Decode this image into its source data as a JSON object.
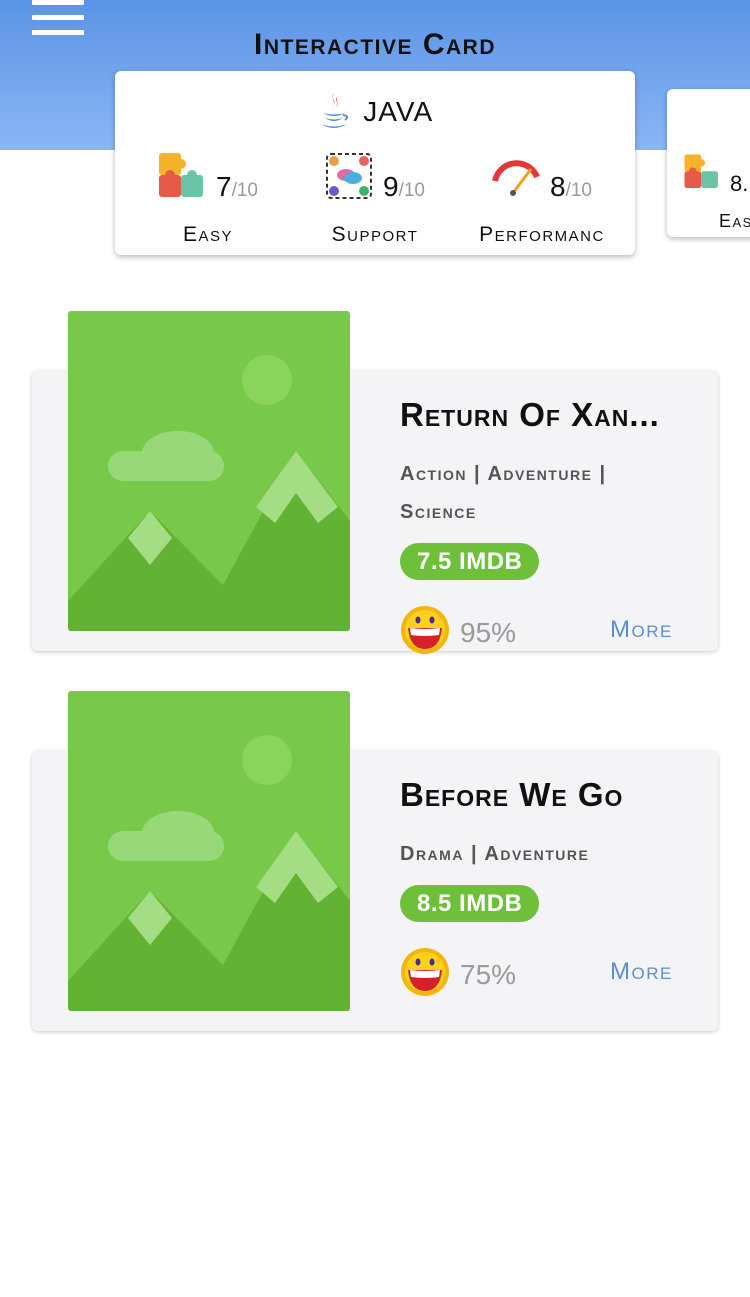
{
  "header": {
    "title": "Interactive Card"
  },
  "lang_cards": [
    {
      "name": "JAVA",
      "metrics": [
        {
          "icon": "puzzle-icon",
          "score": "7",
          "max": "/10",
          "label": "Easy"
        },
        {
          "icon": "support-people-icon",
          "score": "9",
          "max": "/10",
          "label": "Support"
        },
        {
          "icon": "speedometer-icon",
          "score": "8",
          "max": "/10",
          "label": "Performanc"
        }
      ]
    },
    {
      "metrics": [
        {
          "icon": "puzzle-icon",
          "score": "8.",
          "label": "Eas"
        }
      ]
    }
  ],
  "movies": [
    {
      "title": "Return Of Xan...",
      "genres": "Action | Adventure | Science",
      "imdb": "7.5 IMDB",
      "rating": "95%",
      "more": "More"
    },
    {
      "title": "Before We Go",
      "genres": "Drama | Adventure",
      "imdb": "8.5 IMDB",
      "rating": "75%",
      "more": "More"
    }
  ],
  "colors": {
    "header_top": "#5b94e6",
    "header_bottom": "#8bb6f5",
    "badge": "#6ebf3a",
    "link": "#5a8fd0",
    "card_bg": "#f4f4f6"
  }
}
